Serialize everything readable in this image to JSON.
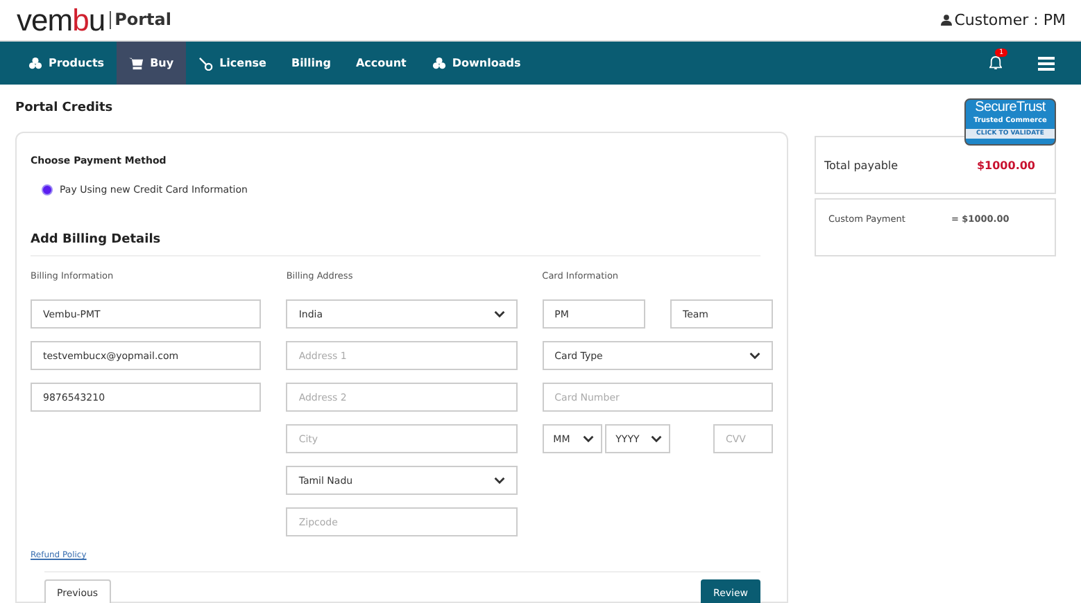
{
  "header": {
    "logo": [
      {
        "text": "vem",
        "accent": false
      },
      {
        "text": "b",
        "accent": true
      },
      {
        "text": "u",
        "accent": false
      }
    ],
    "product": "Portal",
    "user": "Customer : PM"
  },
  "nav": {
    "items": [
      {
        "label": "Products",
        "kind": "cubes",
        "selected": false
      },
      {
        "label": "Buy",
        "kind": "cart",
        "selected": true
      },
      {
        "label": "License",
        "kind": "key",
        "selected": false
      },
      {
        "label": "Billing",
        "kind": "plain",
        "selected": false
      },
      {
        "label": "Account",
        "kind": "plain",
        "selected": false
      },
      {
        "label": "Downloads",
        "kind": "cubes",
        "selected": false
      }
    ],
    "notification_count": "1"
  },
  "page_title": "Portal Credits",
  "payment": {
    "heading": "Choose Payment Method",
    "options": [
      {
        "label": "Pay Using new Credit Card Information",
        "selected": true
      }
    ]
  },
  "billing": {
    "heading": "Add Billing Details",
    "columns": [
      {
        "title": "Billing Information",
        "rows": [
          [
            {
              "kind": "input",
              "value": "Vembu-PMT"
            }
          ],
          [
            {
              "kind": "input",
              "value": "testvembucx@yopmail.com"
            }
          ],
          [
            {
              "kind": "input",
              "value": "9876543210"
            }
          ]
        ]
      },
      {
        "title": "Billing Address",
        "rows": [
          [
            {
              "kind": "select",
              "value": "India"
            }
          ],
          [
            {
              "kind": "input",
              "placeholder": "Address 1"
            }
          ],
          [
            {
              "kind": "input",
              "placeholder": "Address 2"
            }
          ],
          [
            {
              "kind": "input",
              "placeholder": "City"
            }
          ],
          [
            {
              "kind": "select",
              "value": "Tamil Nadu"
            }
          ],
          [
            {
              "kind": "input",
              "placeholder": "Zipcode"
            }
          ]
        ]
      },
      {
        "title": "Card Information",
        "rows": [
          [
            {
              "kind": "short-input",
              "value": "PM"
            },
            {
              "kind": "short-input",
              "value": "Team"
            }
          ],
          [
            {
              "kind": "select",
              "value": "Card Type"
            }
          ],
          [
            {
              "kind": "input",
              "placeholder": "Card Number"
            }
          ],
          [
            {
              "kind": "short-select",
              "value": "MM"
            },
            {
              "kind": "short-select",
              "value": "YYYY"
            },
            {
              "kind": "short-input",
              "placeholder": "CVV"
            }
          ]
        ]
      }
    ]
  },
  "refund_link": "Refund Policy",
  "buttons": {
    "previous": "Previous",
    "review": "Review"
  },
  "badge": {
    "brand": "SecureTrust",
    "subtitle": "Trusted Commerce",
    "action": "CLICK TO VALIDATE"
  },
  "summary": {
    "total_label": "Total payable",
    "total_value": "$1000.00",
    "lines": [
      {
        "label": "Custom Payment",
        "value": "= $1000.00"
      }
    ]
  }
}
